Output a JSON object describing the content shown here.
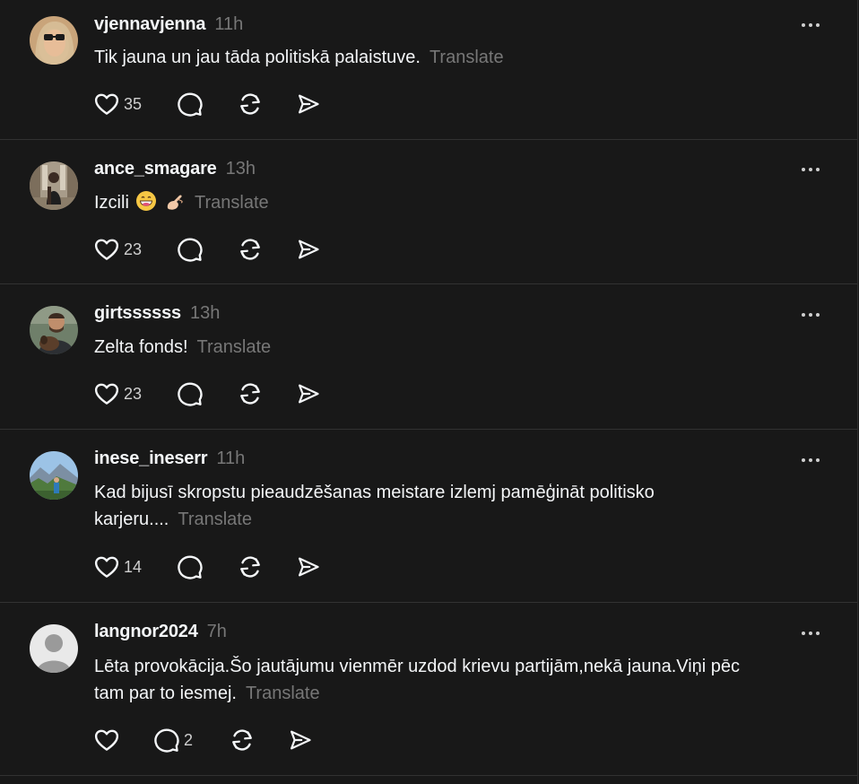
{
  "posts": [
    {
      "username": "vjennavjenna",
      "time": "11h",
      "text": "Tik jauna un jau tāda politiskā palaistuve.",
      "translate": "Translate",
      "likes": "35",
      "replies": "",
      "avatar": "avatar-woman-sunglasses"
    },
    {
      "username": "ance_smagare",
      "time": "13h",
      "text": "Izcili",
      "emojis": [
        "grinning-face-emoji",
        "pinching-hand-emoji"
      ],
      "translate": "Translate",
      "likes": "23",
      "replies": "",
      "avatar": "avatar-woman-hall"
    },
    {
      "username": "girtssssss",
      "time": "13h",
      "text": "Zelta fonds!",
      "translate": "Translate",
      "likes": "23",
      "replies": "",
      "avatar": "avatar-man-with-dog"
    },
    {
      "username": "inese_ineserr",
      "time": "11h",
      "text_line1": "Kad bijusī skropstu pieaudzēšanas meistare izlemj pamēģināt politisko",
      "text_line2": "karjeru....",
      "translate": "Translate",
      "likes": "14",
      "replies": "",
      "avatar": "avatar-outdoor-mountain"
    },
    {
      "username": "langnor2024",
      "time": "7h",
      "text_line1": "Lēta provokācija.Šo jautājumu vienmēr uzdod krievu partijām,nekā jauna.Viņi pēc",
      "text_line2": "tam par to iesmej.",
      "translate": "Translate",
      "likes": "",
      "replies": "2",
      "avatar": "avatar-default-silhouette"
    }
  ],
  "icons": {
    "like": "heart-icon",
    "reply": "comment-icon",
    "repost": "repost-icon",
    "share": "send-icon",
    "more": "more-dots-icon"
  },
  "colors": {
    "background": "#181818",
    "text": "#f3f5f7",
    "muted": "#777777",
    "divider": "#323232"
  }
}
